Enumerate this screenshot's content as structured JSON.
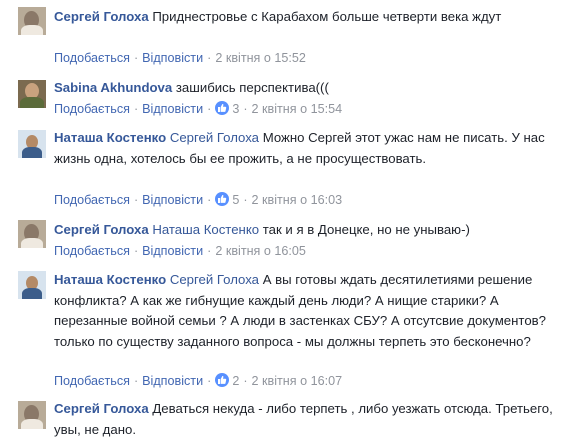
{
  "actions": {
    "like": "Подобається",
    "reply": "Відповісти",
    "sep": "·"
  },
  "comments": [
    {
      "author": "Сергей Голоха",
      "mention": "",
      "text": "Приднестровье с Карабахом больше четверти века ждут",
      "likes": "",
      "time": "2 квітня о 15:52"
    },
    {
      "author": "Sabina Akhundova",
      "mention": "",
      "text": "зашибись перспектива(((",
      "likes": "3",
      "time": "2 квітня о 15:54"
    },
    {
      "author": "Наташа Костенко",
      "mention": "Сергей Голоха",
      "text": "Можно Сергей этот ужас нам не писать. У нас жизнь одна, хотелось бы ее прожить, а не просуществовать.",
      "likes": "5",
      "time": "2 квітня о 16:03"
    },
    {
      "author": "Сергей Голоха",
      "mention": "Наташа Костенко",
      "text": "так и я в Донецке, но не унываю-)",
      "likes": "",
      "time": "2 квітня о 16:05"
    },
    {
      "author": "Наташа Костенко",
      "mention": "Сергей Голоха",
      "text": "А вы готовы ждать десятилетиями решение конфликта? А как же гибнущие каждый день люди? А нищие старики? А перезанные войной семьи ? А люди в застенках СБУ? А отсутсвие документов? только по существу заданного вопроса - мы должны терпеть это бесконечно?",
      "likes": "2",
      "time": "2 квітня о 16:07"
    },
    {
      "author": "Сергей Голоха",
      "mention": "",
      "text": "Деваться некуда - либо терпеть , либо уезжать отсюда. Третьего, увы, не дано.",
      "likes": "",
      "time": ""
    }
  ],
  "colors": {
    "link": "#365899",
    "meta": "#90949c",
    "like_badge": "#5890ff",
    "text": "#1d2129"
  }
}
